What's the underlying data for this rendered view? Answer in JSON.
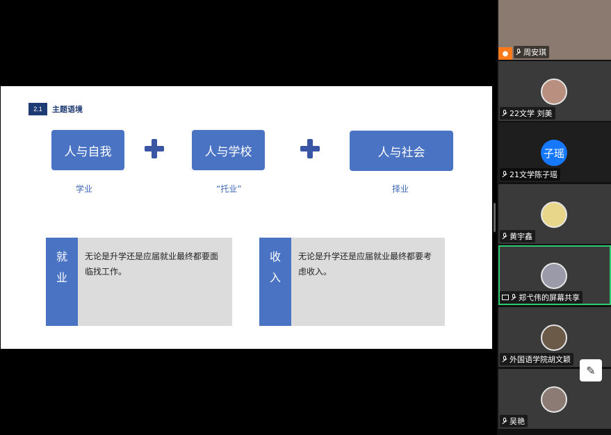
{
  "slide": {
    "section_number": "2.1",
    "section_title": "主题语境",
    "boxes": [
      "人与自我",
      "人与学校",
      "人与社会"
    ],
    "sub_labels": [
      "学业",
      "“托业”",
      "择业"
    ],
    "cards": [
      {
        "side_chars": [
          "就",
          "业"
        ],
        "text": "无论是升学还是应届就业最终都要面临找工作。"
      },
      {
        "side_chars": [
          "收",
          "入"
        ],
        "text": "无论是升学还是应届就业最终都要考虑收入。"
      }
    ]
  },
  "participants": [
    {
      "name": "周安琪",
      "host": true
    },
    {
      "name": "22文学 刘美"
    },
    {
      "name": "21文学陈子瑶",
      "avatar_text": "子瑶"
    },
    {
      "name": "黄宇鑫"
    },
    {
      "name": "郑弋伟的屏幕共享",
      "sharing": true
    },
    {
      "name": "外国语学院胡文颖"
    },
    {
      "name": "吴艳"
    }
  ],
  "icons": {
    "mic": "microphone-icon",
    "share": "screen-share-icon",
    "host": "host-icon",
    "float": "edit-annotate-icon"
  },
  "colors": {
    "accent_blue": "#4a73c4",
    "plus_blue": "#3a55a4",
    "active_border": "#2ecc71",
    "avatar_blue": "#1677ff"
  }
}
